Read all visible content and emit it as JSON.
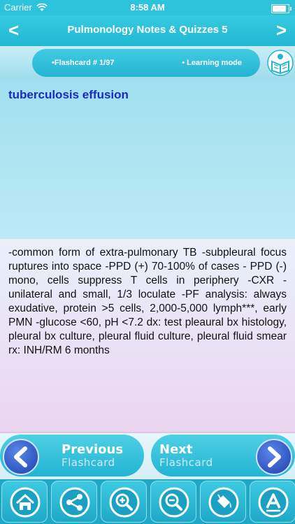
{
  "status_bar": {
    "carrier": "Carrier",
    "time": "8:58 AM",
    "battery_level": 0.95
  },
  "nav": {
    "back_glyph": "<",
    "title": "Pulmonology Notes & Quizzes 5",
    "forward_glyph": ">"
  },
  "mode_bar": {
    "card_label": "•Flashcard #  1/97",
    "mode_label": "• Learning mode",
    "icon": "book-reader-icon"
  },
  "card": {
    "question": "tuberculosis effusion",
    "answer": "-common form of extra-pulmonary TB -subpleural focus ruptures into space -PPD (+) 70-100% of cases - PPD (-) mono, cells suppress T cells in periphery -CXR - unilateral and small, 1/3 loculate -PF analysis: always exudative, protein >5 cells, 2,000-5,000 lymph***, early PMN -glucose <60, pH <7.2 dx: test pleaural bx histology, pleural bx culture, pleural fluid culture, pleural fluid smear rx: INH/RM 6 months"
  },
  "navigation": {
    "previous": {
      "line1": "Previous",
      "line2": "Flashcard"
    },
    "next": {
      "line1": "Next",
      "line2": "Flashcard"
    }
  },
  "toolbar": {
    "items": [
      "home-icon",
      "share-icon",
      "zoom-in-icon",
      "zoom-out-icon",
      "paint-bucket-icon",
      "font-icon"
    ]
  },
  "colors": {
    "accent": "#22b5d3",
    "question_text": "#1b29c6",
    "arrow_circle": "#1e3fb0"
  }
}
